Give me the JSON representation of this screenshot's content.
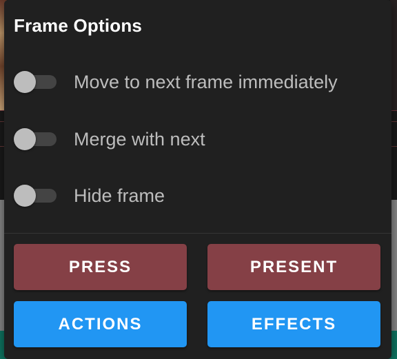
{
  "dialog": {
    "title": "Frame Options",
    "options": [
      {
        "label": "Move to next frame immediately",
        "enabled": false
      },
      {
        "label": "Merge with next",
        "enabled": false
      },
      {
        "label": "Hide frame",
        "enabled": false
      }
    ],
    "buttons": {
      "press": "PRESS",
      "present": "PRESENT",
      "actions": "ACTIONS",
      "effects": "EFFECTS"
    },
    "colors": {
      "dialog_bg": "#202020",
      "primary_button": "#2196f3",
      "secondary_button": "#854046",
      "switch_thumb_off": "#bdbdbd",
      "switch_track_off": "#444444"
    }
  }
}
